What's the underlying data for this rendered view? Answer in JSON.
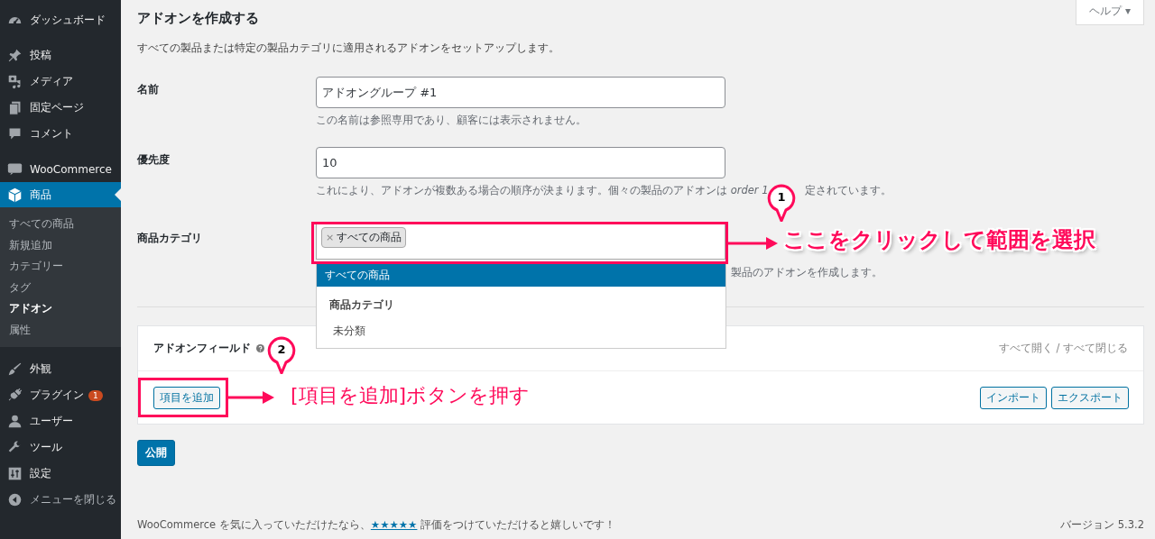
{
  "sidebar": {
    "items": [
      {
        "label": "ダッシュボード",
        "selected": false
      },
      {
        "label": "投稿",
        "selected": false
      },
      {
        "label": "メディア",
        "selected": false
      },
      {
        "label": "固定ページ",
        "selected": false
      },
      {
        "label": "コメント",
        "selected": false
      },
      {
        "label": "WooCommerce",
        "selected": false
      },
      {
        "label": "商品",
        "selected": true,
        "children": [
          {
            "label": "すべての商品",
            "selected": false
          },
          {
            "label": "新規追加",
            "selected": false
          },
          {
            "label": "カテゴリー",
            "selected": false
          },
          {
            "label": "タグ",
            "selected": false
          },
          {
            "label": "アドオン",
            "selected": true
          },
          {
            "label": "属性",
            "selected": false
          }
        ]
      },
      {
        "label": "外観",
        "selected": false
      },
      {
        "label": "プラグイン",
        "selected": false,
        "badge": "1"
      },
      {
        "label": "ユーザー",
        "selected": false
      },
      {
        "label": "ツール",
        "selected": false
      },
      {
        "label": "設定",
        "selected": false
      },
      {
        "label": "メニューを閉じる",
        "selected": false
      }
    ]
  },
  "page": {
    "title": "アドオンを作成する",
    "help_button": "ヘルプ ▾",
    "description": "すべての製品または特定の製品カテゴリに適用されるアドオンをセットアップします。",
    "name_field": {
      "label": "名前",
      "value": "アドオングループ #1",
      "hint": "この名前は参照専用であり、顧客には表示されません。"
    },
    "priority_field": {
      "label": "優先度",
      "value": "10",
      "hint": "これにより、アドオンが複数ある場合の順序が決まります。個々の製品のアドオンは *order 1*",
      "hint_rest": "定されています。"
    },
    "category_field": {
      "label": "商品カテゴリ",
      "tag_remove": "×",
      "tag": "すべての商品",
      "hint": "製品のアドオンを作成します。",
      "dropdown": [
        {
          "kind": "option",
          "label": "すべての商品",
          "selected": true
        },
        {
          "kind": "group",
          "label": "商品カテゴリ"
        },
        {
          "kind": "option",
          "label": "未分類",
          "selected": false
        }
      ]
    },
    "addon_fields": {
      "title": "アドオンフィールド",
      "expand_collapse": "すべて開く / すべて閉じる",
      "add_button": "項目を追加",
      "import_button": "インポート",
      "export_button": "エクスポート"
    },
    "publish_button": "公開"
  },
  "footer": {
    "text_before": "WooCommerce を気に入っていただけたなら、",
    "rating_link": "★★★★★",
    "text_after": " 評価をつけていただけると嬉しいです！",
    "version": "バージョン 5.3.2"
  },
  "annotations": [
    {
      "number": "1",
      "text": "ここをクリックして範囲を選択"
    },
    {
      "number": "2",
      "text": "[項目を追加]ボタンを押す"
    }
  ]
}
